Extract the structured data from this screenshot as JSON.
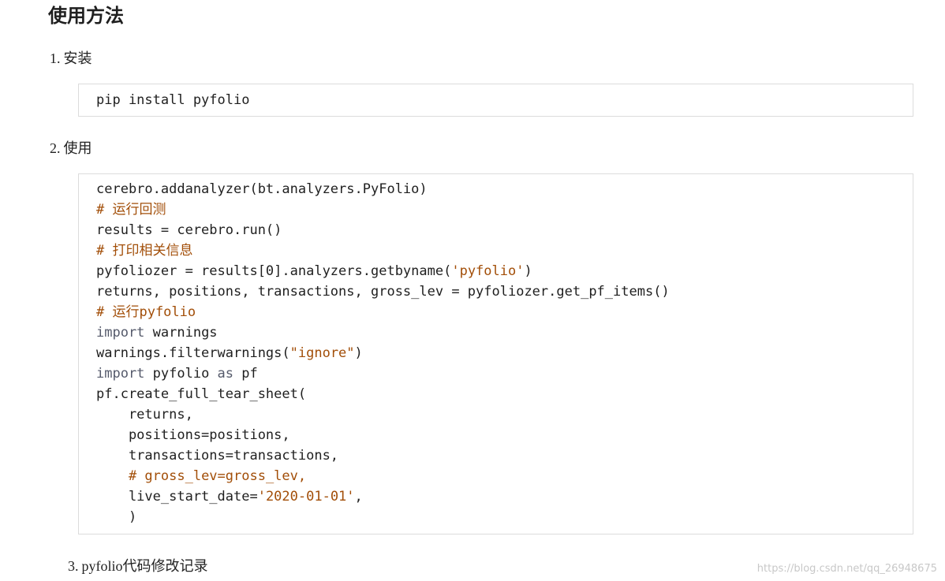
{
  "heading": "使用方法",
  "steps": [
    {
      "num": "1.",
      "label": "安装"
    },
    {
      "num": "2.",
      "label": "使用"
    },
    {
      "num": "3.",
      "label": "pyfolio代码修改记录"
    }
  ],
  "install_code": "pip install pyfolio",
  "usage_code": [
    [
      {
        "t": "plain",
        "s": "cerebro.addanalyzer(bt.analyzers.PyFolio)"
      }
    ],
    [
      {
        "t": "comment",
        "s": "# 运行回测"
      }
    ],
    [
      {
        "t": "plain",
        "s": "results = cerebro.run()"
      }
    ],
    [
      {
        "t": "comment",
        "s": "# 打印相关信息"
      }
    ],
    [
      {
        "t": "plain",
        "s": "pyfoliozer = results[0].analyzers.getbyname("
      },
      {
        "t": "string",
        "s": "'pyfolio'"
      },
      {
        "t": "plain",
        "s": ")"
      }
    ],
    [
      {
        "t": "plain",
        "s": "returns, positions, transactions, gross_lev = pyfoliozer.get_pf_items()"
      }
    ],
    [
      {
        "t": "comment",
        "s": "# 运行pyfolio"
      }
    ],
    [
      {
        "t": "keyword",
        "s": "import"
      },
      {
        "t": "plain",
        "s": " warnings"
      }
    ],
    [
      {
        "t": "plain",
        "s": "warnings.filterwarnings("
      },
      {
        "t": "string",
        "s": "\"ignore\""
      },
      {
        "t": "plain",
        "s": ")"
      }
    ],
    [
      {
        "t": "keyword",
        "s": "import"
      },
      {
        "t": "plain",
        "s": " pyfolio "
      },
      {
        "t": "keyword",
        "s": "as"
      },
      {
        "t": "plain",
        "s": " pf"
      }
    ],
    [
      {
        "t": "plain",
        "s": "pf.create_full_tear_sheet("
      }
    ],
    [
      {
        "t": "plain",
        "s": "    returns,"
      }
    ],
    [
      {
        "t": "plain",
        "s": "    positions=positions,"
      }
    ],
    [
      {
        "t": "plain",
        "s": "    transactions=transactions,"
      }
    ],
    [
      {
        "t": "plain",
        "s": "    "
      },
      {
        "t": "comment",
        "s": "# gross_lev=gross_lev,"
      }
    ],
    [
      {
        "t": "plain",
        "s": "    live_start_date="
      },
      {
        "t": "string",
        "s": "'2020-01-01'"
      },
      {
        "t": "plain",
        "s": ","
      }
    ],
    [
      {
        "t": "plain",
        "s": "    )"
      }
    ]
  ],
  "watermark": "https://blog.csdn.net/qq_26948675"
}
